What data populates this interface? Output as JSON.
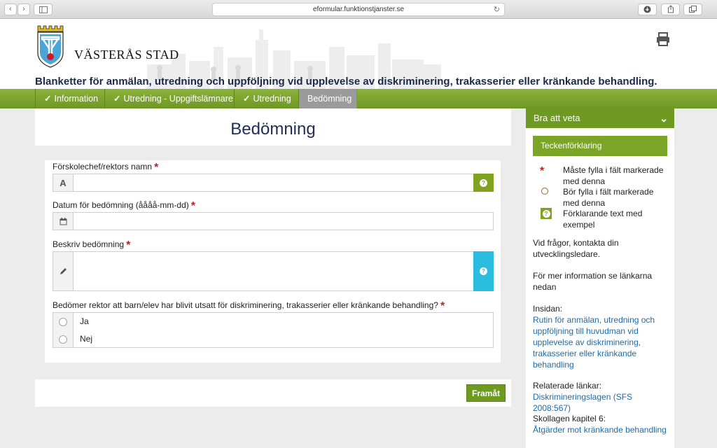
{
  "browser": {
    "url": "eformular.funktionstjanster.se"
  },
  "header": {
    "logo_text": "VÄSTERÅS STAD",
    "title": "Blanketter för anmälan, utredning och uppföljning vid upplevelse av diskriminering, trakasserier eller kränkande behandling."
  },
  "nav": {
    "tabs": [
      {
        "label": "Information",
        "done": true
      },
      {
        "label": "Utredning - Uppgiftslämnare",
        "done": true
      },
      {
        "label": "Utredning",
        "done": true
      },
      {
        "label": "Bedömning",
        "done": false,
        "active": true
      }
    ]
  },
  "main": {
    "page_title": "Bedömning",
    "fields": {
      "name_label": "Förskolechef/rektors namn",
      "date_label": "Datum för bedömning (åååå-mm-dd)",
      "describe_label": "Beskriv bedömning",
      "question_label": "Bedömer rektor att barn/elev har blivit utsatt för diskriminering, trakasserier eller kränkande behandling?"
    },
    "required_mark": "*",
    "text_prefix": "A",
    "radio_options": [
      "Ja",
      "Nej"
    ],
    "next_button": "Framåt"
  },
  "sidebar": {
    "header": "Bra att veta",
    "legend_title": "Teckenförklaring",
    "legend": {
      "required": "Måste fylla i fält markerade med denna",
      "optional": "Bör fylla i fält markerade med denna",
      "help": "Förklarande text med exempel"
    },
    "contact": "Vid frågor, kontakta din utvecklingsledare.",
    "more_info": "För mer information se länkarna nedan",
    "insidan_label": "Insidan:",
    "insidan_link": "Rutin för anmälan, utredning och uppföljning till huvudman vid upplevelse av diskriminering, trakasserier eller kränkande behandling",
    "related_label": "Relaterade länkar:",
    "related_link": "Diskrimineringslagen (SFS 2008:567)",
    "skollagen_label": "Skollagen kapitel 6:",
    "skollagen_link": "Åtgärder mot kränkande behandling"
  },
  "colors": {
    "accent_green": "#6f9a21",
    "help_cyan": "#2bbde0",
    "required_red": "#b0262b",
    "title_navy": "#1f2e55"
  }
}
